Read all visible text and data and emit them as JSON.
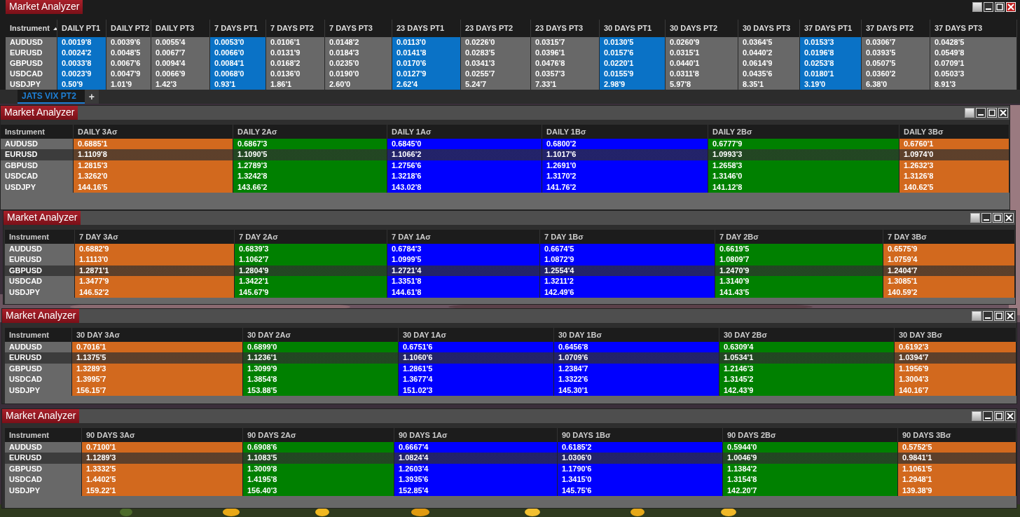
{
  "top_window": {
    "title": "Market Analyzer",
    "instrument_header": {
      "label": "Instrument",
      "sorted_ascending": true
    },
    "columns": [
      {
        "label": "DAILY PT1",
        "highlighted": true
      },
      {
        "label": "DAILY PT2",
        "highlighted": false
      },
      {
        "label": "DAILY PT3",
        "highlighted": false
      },
      {
        "label": "7 DAYS PT1",
        "highlighted": true
      },
      {
        "label": "7 DAYS PT2",
        "highlighted": false
      },
      {
        "label": "7 DAYS PT3",
        "highlighted": false
      },
      {
        "label": "23 DAYS PT1",
        "highlighted": true
      },
      {
        "label": "23 DAYS PT2",
        "highlighted": false
      },
      {
        "label": "23 DAYS PT3",
        "highlighted": false
      },
      {
        "label": "30 DAYS PT1",
        "highlighted": true
      },
      {
        "label": "30 DAYS PT2",
        "highlighted": false
      },
      {
        "label": "30 DAYS PT3",
        "highlighted": false
      },
      {
        "label": "37 DAYS PT1",
        "highlighted": true
      },
      {
        "label": "37 DAYS PT2",
        "highlighted": false
      },
      {
        "label": "37 DAYS PT3",
        "highlighted": false
      }
    ],
    "rows": [
      {
        "instrument": "AUDUSD",
        "values": [
          "0.0019'8",
          "0.0039'6",
          "0.0055'4",
          "0.0053'0",
          "0.0106'1",
          "0.0148'2",
          "0.0113'0",
          "0.0226'0",
          "0.0315'7",
          "0.0130'5",
          "0.0260'9",
          "0.0364'5",
          "0.0153'3",
          "0.0306'7",
          "0.0428'5"
        ]
      },
      {
        "instrument": "EURUSD",
        "values": [
          "0.0024'2",
          "0.0048'5",
          "0.0067'7",
          "0.0066'0",
          "0.0131'9",
          "0.0184'3",
          "0.0141'8",
          "0.0283'5",
          "0.0396'1",
          "0.0157'6",
          "0.0315'1",
          "0.0440'2",
          "0.0196'8",
          "0.0393'5",
          "0.0549'8"
        ]
      },
      {
        "instrument": "GBPUSD",
        "values": [
          "0.0033'8",
          "0.0067'6",
          "0.0094'4",
          "0.0084'1",
          "0.0168'2",
          "0.0235'0",
          "0.0170'6",
          "0.0341'3",
          "0.0476'8",
          "0.0220'1",
          "0.0440'1",
          "0.0614'9",
          "0.0253'8",
          "0.0507'5",
          "0.0709'1"
        ]
      },
      {
        "instrument": "USDCAD",
        "values": [
          "0.0023'9",
          "0.0047'9",
          "0.0066'9",
          "0.0068'0",
          "0.0136'0",
          "0.0190'0",
          "0.0127'9",
          "0.0255'7",
          "0.0357'3",
          "0.0155'9",
          "0.0311'8",
          "0.0435'6",
          "0.0180'1",
          "0.0360'2",
          "0.0503'3"
        ]
      },
      {
        "instrument": "USDJPY",
        "values": [
          "0.50'9",
          "1.01'9",
          "1.42'3",
          "0.93'1",
          "1.86'1",
          "2.60'0",
          "2.62'4",
          "5.24'7",
          "7.33'1",
          "2.98'9",
          "5.97'8",
          "8.35'1",
          "3.19'0",
          "6.38'0",
          "8.91'3"
        ]
      }
    ]
  },
  "tabs": [
    {
      "label": "JATS VIX PT2",
      "selected": true
    }
  ],
  "add_tab": "+",
  "band_windows": [
    {
      "title": "Market Analyzer",
      "instrument_header": "Instrument",
      "columns": [
        {
          "label": "DAILY 3Aσ",
          "color": "#d2691e"
        },
        {
          "label": "DAILY 2Aσ",
          "color": "#008000"
        },
        {
          "label": "DAILY 1Aσ",
          "color": "#0000ff"
        },
        {
          "label": "DAILY 1Bσ",
          "color": "#0000ff"
        },
        {
          "label": "DAILY 2Bσ",
          "color": "#008000"
        },
        {
          "label": "DAILY 3Bσ",
          "color": "#d2691e"
        }
      ],
      "rows": [
        {
          "instrument": "AUDUSD",
          "selected": false,
          "values": [
            "0.6885'1",
            "0.6867'3",
            "0.6845'0",
            "0.6800'2",
            "0.6777'9",
            "0.6760'1"
          ]
        },
        {
          "instrument": "EURUSD",
          "selected": true,
          "values": [
            "1.1109'8",
            "1.1090'5",
            "1.1066'2",
            "1.1017'6",
            "1.0993'3",
            "1.0974'0"
          ]
        },
        {
          "instrument": "GBPUSD",
          "selected": false,
          "values": [
            "1.2815'3",
            "1.2789'3",
            "1.2756'6",
            "1.2691'0",
            "1.2658'3",
            "1.2632'3"
          ]
        },
        {
          "instrument": "USDCAD",
          "selected": false,
          "values": [
            "1.3262'0",
            "1.3242'8",
            "1.3218'6",
            "1.3170'2",
            "1.3146'0",
            "1.3126'8"
          ]
        },
        {
          "instrument": "USDJPY",
          "selected": false,
          "values": [
            "144.16'5",
            "143.66'2",
            "143.02'8",
            "141.76'2",
            "141.12'8",
            "140.62'5"
          ]
        }
      ]
    },
    {
      "title": "Market Analyzer",
      "instrument_header": "Instrument",
      "columns": [
        {
          "label": "7 DAY 3Aσ",
          "color": "#d2691e"
        },
        {
          "label": "7 DAY 2Aσ",
          "color": "#008000"
        },
        {
          "label": "7 DAY 1Aσ",
          "color": "#0000ff"
        },
        {
          "label": "7 DAY 1Bσ",
          "color": "#0000ff"
        },
        {
          "label": "7 DAY 2Bσ",
          "color": "#008000"
        },
        {
          "label": "7 DAY 3Bσ",
          "color": "#d2691e"
        }
      ],
      "rows": [
        {
          "instrument": "AUDUSD",
          "selected": false,
          "values": [
            "0.6882'9",
            "0.6839'3",
            "0.6784'3",
            "0.6674'5",
            "0.6619'5",
            "0.6575'9"
          ]
        },
        {
          "instrument": "EURUSD",
          "selected": false,
          "values": [
            "1.1113'0",
            "1.1062'7",
            "1.0999'5",
            "1.0872'9",
            "1.0809'7",
            "1.0759'4"
          ]
        },
        {
          "instrument": "GBPUSD",
          "selected": true,
          "values": [
            "1.2871'1",
            "1.2804'9",
            "1.2721'4",
            "1.2554'4",
            "1.2470'9",
            "1.2404'7"
          ]
        },
        {
          "instrument": "USDCAD",
          "selected": false,
          "values": [
            "1.3477'9",
            "1.3422'1",
            "1.3351'8",
            "1.3211'2",
            "1.3140'9",
            "1.3085'1"
          ]
        },
        {
          "instrument": "USDJPY",
          "selected": false,
          "values": [
            "146.52'2",
            "145.67'9",
            "144.61'8",
            "142.49'6",
            "141.43'5",
            "140.59'2"
          ]
        }
      ]
    },
    {
      "title": "Market Analyzer",
      "instrument_header": "Instrument",
      "columns": [
        {
          "label": "30 DAY 3Aσ",
          "color": "#d2691e"
        },
        {
          "label": "30 DAY 2Aσ",
          "color": "#008000"
        },
        {
          "label": "30 DAY 1Aσ",
          "color": "#0000ff"
        },
        {
          "label": "30 DAY 1Bσ",
          "color": "#0000ff"
        },
        {
          "label": "30 DAY 2Bσ",
          "color": "#008000"
        },
        {
          "label": "30 DAY 3Bσ",
          "color": "#d2691e"
        }
      ],
      "rows": [
        {
          "instrument": "AUDUSD",
          "selected": false,
          "values": [
            "0.7016'1",
            "0.6899'0",
            "0.6751'6",
            "0.6456'8",
            "0.6309'4",
            "0.6192'3"
          ]
        },
        {
          "instrument": "EURUSD",
          "selected": true,
          "values": [
            "1.1375'5",
            "1.1236'1",
            "1.1060'6",
            "1.0709'6",
            "1.0534'1",
            "1.0394'7"
          ]
        },
        {
          "instrument": "GBPUSD",
          "selected": false,
          "values": [
            "1.3289'3",
            "1.3099'9",
            "1.2861'5",
            "1.2384'7",
            "1.2146'3",
            "1.1956'9"
          ]
        },
        {
          "instrument": "USDCAD",
          "selected": false,
          "values": [
            "1.3995'7",
            "1.3854'8",
            "1.3677'4",
            "1.3322'6",
            "1.3145'2",
            "1.3004'3"
          ]
        },
        {
          "instrument": "USDJPY",
          "selected": false,
          "values": [
            "156.15'7",
            "153.88'5",
            "151.02'3",
            "145.30'1",
            "142.43'9",
            "140.16'7"
          ]
        }
      ]
    },
    {
      "title": "Market Analyzer",
      "instrument_header": "Instrument",
      "columns": [
        {
          "label": "90 DAYS 3Aσ",
          "color": "#d2691e"
        },
        {
          "label": "90 DAYS 2Aσ",
          "color": "#008000"
        },
        {
          "label": "90 DAYS 1Aσ",
          "color": "#0000ff"
        },
        {
          "label": "90 DAYS 1Bσ",
          "color": "#0000ff"
        },
        {
          "label": "90 DAYS 2Bσ",
          "color": "#008000"
        },
        {
          "label": "90 DAYS 3Bσ",
          "color": "#d2691e"
        }
      ],
      "rows": [
        {
          "instrument": "AUDUSD",
          "selected": false,
          "values": [
            "0.7100'1",
            "0.6908'6",
            "0.6667'4",
            "0.6185'2",
            "0.5944'0",
            "0.5752'5"
          ]
        },
        {
          "instrument": "EURUSD",
          "selected": true,
          "values": [
            "1.1289'3",
            "1.1083'5",
            "1.0824'4",
            "1.0306'0",
            "1.0046'9",
            "0.9841'1"
          ]
        },
        {
          "instrument": "GBPUSD",
          "selected": false,
          "values": [
            "1.3332'5",
            "1.3009'8",
            "1.2603'4",
            "1.1790'6",
            "1.1384'2",
            "1.1061'5"
          ]
        },
        {
          "instrument": "USDCAD",
          "selected": false,
          "values": [
            "1.4402'5",
            "1.4195'8",
            "1.3935'6",
            "1.3415'0",
            "1.3154'8",
            "1.2948'1"
          ]
        },
        {
          "instrument": "USDJPY",
          "selected": false,
          "values": [
            "159.22'1",
            "156.40'3",
            "152.85'4",
            "145.75'6",
            "142.20'7",
            "139.38'9"
          ]
        }
      ]
    }
  ]
}
